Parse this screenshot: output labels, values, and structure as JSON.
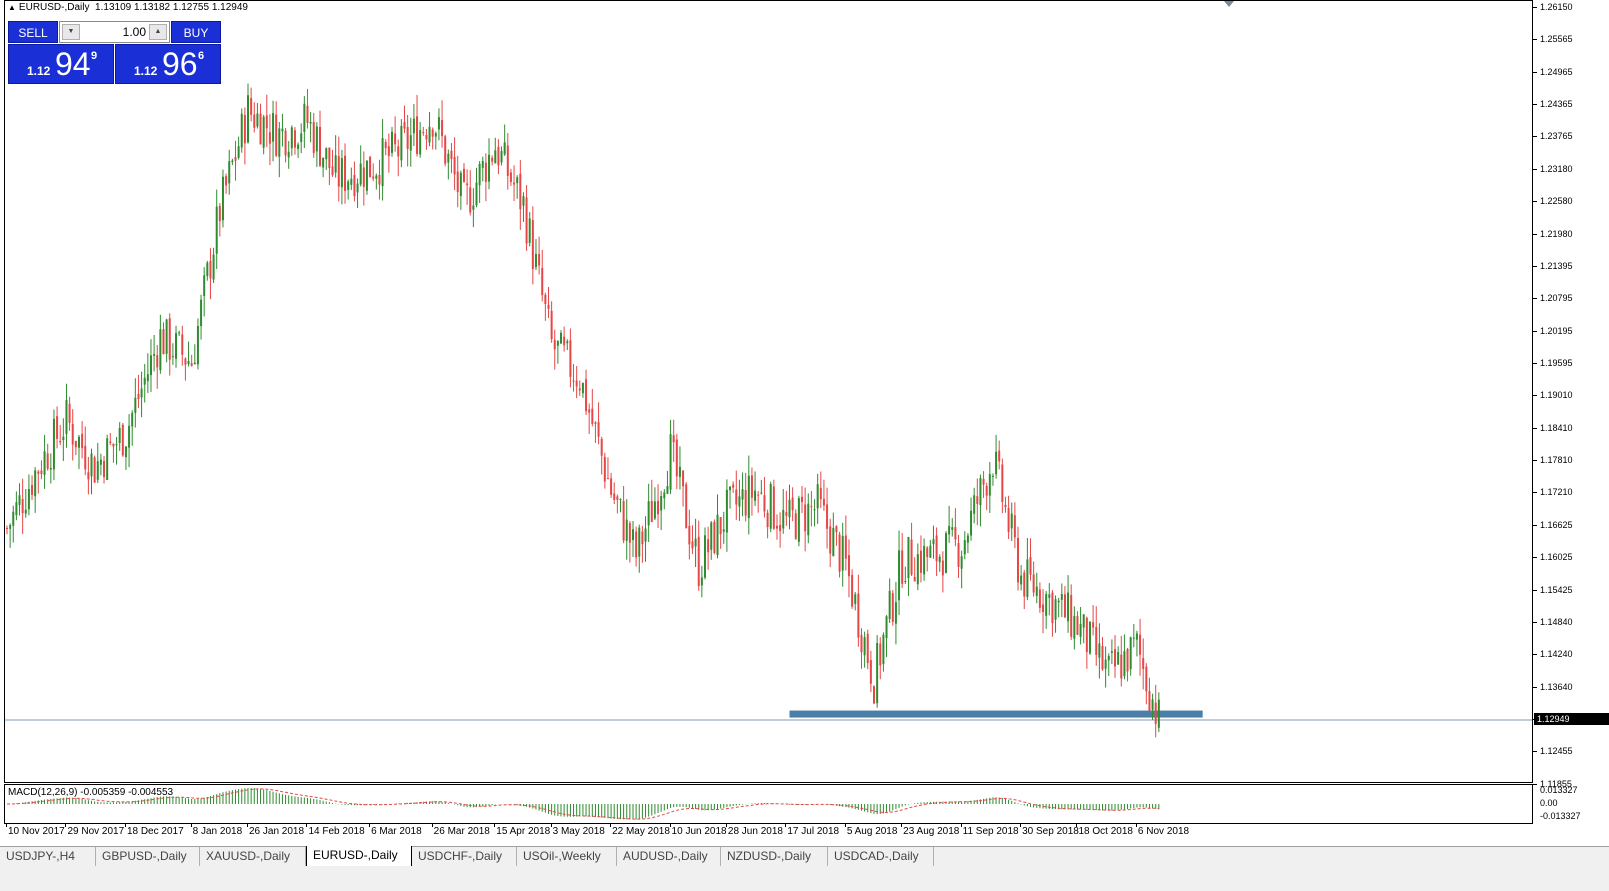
{
  "header": {
    "symbol": "EURUSD-,Daily",
    "ohlc": "1.13109 1.13182 1.12755 1.12949"
  },
  "trade_panel": {
    "sell_label": "SELL",
    "buy_label": "BUY",
    "lot_value": "1.00",
    "sell_price_prefix": "1.12",
    "sell_price_big": "94",
    "sell_price_sup": "9",
    "buy_price_prefix": "1.12",
    "buy_price_big": "96",
    "buy_price_sup": "6"
  },
  "price_axis": {
    "labels": [
      "1.26150",
      "1.25565",
      "1.24965",
      "1.24365",
      "1.23765",
      "1.23180",
      "1.22580",
      "1.21980",
      "1.21395",
      "1.20795",
      "1.20195",
      "1.19595",
      "1.19010",
      "1.18410",
      "1.17810",
      "1.17210",
      "1.16625",
      "1.16025",
      "1.15425",
      "1.14840",
      "1.14240",
      "1.13640",
      "1.13040",
      "1.12455",
      "1.11855"
    ],
    "current_price": "1.12949"
  },
  "macd": {
    "label": "MACD(12,26,9) -0.005359 -0.004553",
    "axis_labels": [
      "0.013327",
      "0.00",
      "-0.013327"
    ]
  },
  "time_axis": {
    "labels": [
      "10 Nov 2017",
      "29 Nov 2017",
      "18 Dec 2017",
      "8 Jan 2018",
      "26 Jan 2018",
      "14 Feb 2018",
      "6 Mar 2018",
      "26 Mar 2018",
      "15 Apr 2018",
      "3 May 2018",
      "22 May 2018",
      "10 Jun 2018",
      "28 Jun 2018",
      "17 Jul 2018",
      "5 Aug 2018",
      "23 Aug 2018",
      "11 Sep 2018",
      "30 Sep 2018",
      "18 Oct 2018",
      "6 Nov 2018"
    ]
  },
  "tabs": [
    {
      "label": "USDJPY-,H4",
      "active": false
    },
    {
      "label": "GBPUSD-,Daily",
      "active": false
    },
    {
      "label": "XAUUSD-,Daily",
      "active": false
    },
    {
      "label": "EURUSD-,Daily",
      "active": true
    },
    {
      "label": "USDCHF-,Daily",
      "active": false
    },
    {
      "label": "USOil-,Weekly",
      "active": false
    },
    {
      "label": "AUDUSD-,Daily",
      "active": false
    },
    {
      "label": "NZDUSD-,Daily",
      "active": false
    },
    {
      "label": "USDCAD-,Daily",
      "active": false
    }
  ],
  "colors": {
    "bull": "#2e8b2e",
    "bear": "#e64646",
    "support_zone": "#4a7fa8",
    "macd_hist": "#2e8b2e",
    "macd_signal": "#e64646",
    "trade_button": "#1a30d6"
  },
  "chart_data": {
    "type": "candlestick",
    "symbol": "EURUSD",
    "timeframe": "Daily",
    "ylim": [
      1.11855,
      1.2615
    ],
    "support_zone": {
      "price": 1.1305,
      "from": "18 Jul 2018",
      "to": "27 Nov 2018"
    },
    "current_price": 1.12949,
    "close_path": [
      {
        "date": "10 Nov 2017",
        "close": 1.165
      },
      {
        "date": "20 Nov 2017",
        "close": 1.1765
      },
      {
        "date": "29 Nov 2017",
        "close": 1.185
      },
      {
        "date": "8 Dec 2017",
        "close": 1.1765
      },
      {
        "date": "18 Dec 2017",
        "close": 1.183
      },
      {
        "date": "29 Dec 2017",
        "close": 1.2005
      },
      {
        "date": "8 Jan 2018",
        "close": 1.196
      },
      {
        "date": "17 Jan 2018",
        "close": 1.224
      },
      {
        "date": "26 Jan 2018",
        "close": 1.2425
      },
      {
        "date": "5 Feb 2018",
        "close": 1.238
      },
      {
        "date": "14 Feb 2018",
        "close": 1.2405
      },
      {
        "date": "23 Feb 2018",
        "close": 1.23
      },
      {
        "date": "6 Mar 2018",
        "close": 1.232
      },
      {
        "date": "15 Mar 2018",
        "close": 1.235
      },
      {
        "date": "26 Mar 2018",
        "close": 1.2415
      },
      {
        "date": "5 Apr 2018",
        "close": 1.225
      },
      {
        "date": "15 Apr 2018",
        "close": 1.236
      },
      {
        "date": "24 Apr 2018",
        "close": 1.225
      },
      {
        "date": "3 May 2018",
        "close": 1.199
      },
      {
        "date": "12 May 2018",
        "close": 1.193
      },
      {
        "date": "22 May 2018",
        "close": 1.172
      },
      {
        "date": "30 May 2018",
        "close": 1.16
      },
      {
        "date": "10 Jun 2018",
        "close": 1.179
      },
      {
        "date": "19 Jun 2018",
        "close": 1.158
      },
      {
        "date": "28 Jun 2018",
        "close": 1.168
      },
      {
        "date": "7 Jul 2018",
        "close": 1.172
      },
      {
        "date": "17 Jul 2018",
        "close": 1.166
      },
      {
        "date": "27 Jul 2018",
        "close": 1.169
      },
      {
        "date": "5 Aug 2018",
        "close": 1.158
      },
      {
        "date": "14 Aug 2018",
        "close": 1.137
      },
      {
        "date": "23 Aug 2018",
        "close": 1.159
      },
      {
        "date": "2 Sep 2018",
        "close": 1.16
      },
      {
        "date": "11 Sep 2018",
        "close": 1.162
      },
      {
        "date": "21 Sep 2018",
        "close": 1.178
      },
      {
        "date": "30 Sep 2018",
        "close": 1.156
      },
      {
        "date": "9 Oct 2018",
        "close": 1.152
      },
      {
        "date": "18 Oct 2018",
        "close": 1.147
      },
      {
        "date": "28 Oct 2018",
        "close": 1.138
      },
      {
        "date": "6 Nov 2018",
        "close": 1.143
      },
      {
        "date": "13 Nov 2018",
        "close": 1.1295
      }
    ]
  }
}
